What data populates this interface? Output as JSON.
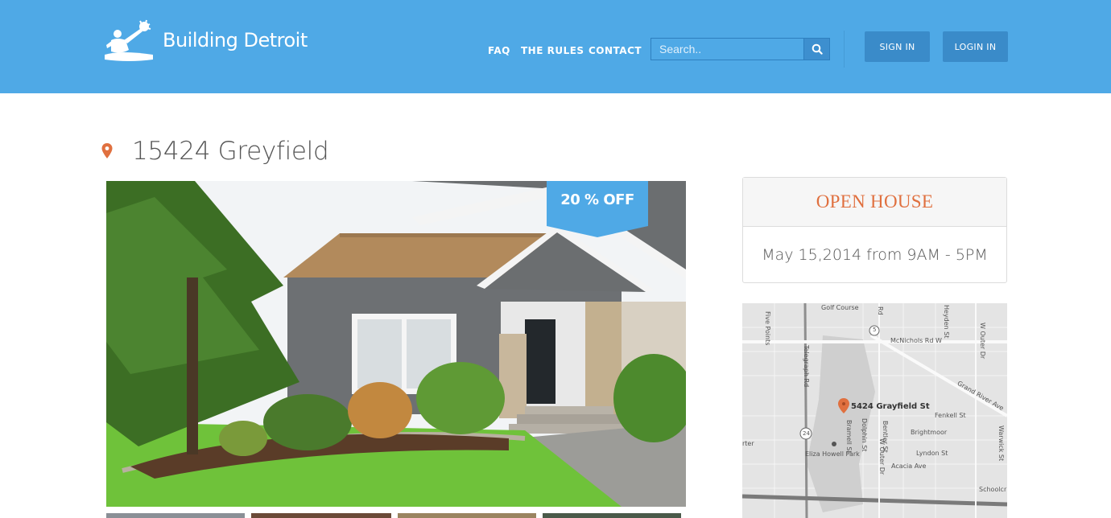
{
  "header": {
    "logo_text": "Building Detroit",
    "nav": {
      "faq": "FAQ",
      "rules": "THE RULES",
      "contact": "CONTACT"
    },
    "search_placeholder": "Search..",
    "sign_in": "SIGN IN",
    "login_in": "LOGIN IN"
  },
  "listing": {
    "title": "15424 Greyfield",
    "discount_badge": "20 % OFF"
  },
  "open_house": {
    "title": "OPEN HOUSE",
    "date": "May 15,2014 from 9AM - 5PM"
  },
  "map": {
    "address_label": "5424 Grayfield St",
    "labels": {
      "golf_course": "Golf Course",
      "mcnichols": "McNichols Rd W",
      "grand_river": "Grand River Ave",
      "fenkell": "Fenkell St",
      "brightmoor": "Brightmoor",
      "lyndon": "Lyndon St",
      "acacia": "Acacia Ave",
      "eliza_park": "Eliza Howell Park",
      "schoolcraft": "Schoolcr",
      "route_24": "24",
      "route_5": "5",
      "arter": "rter",
      "telegraph": "Telegraph Rd",
      "five_points": "Five Points",
      "heyden": "Heyden St",
      "w_outer": "W Outer Dr",
      "bramell": "Bramell St",
      "dolphin": "Dolphin St",
      "bentler": "Bentler St",
      "w_outer2": "W Outer Dr",
      "warwick": "Warwick St",
      "rd": "Rd"
    }
  },
  "colors": {
    "header_bg": "#4fa9e6",
    "accent_orange": "#e0703f",
    "button_bg": "#3a8bc9"
  }
}
